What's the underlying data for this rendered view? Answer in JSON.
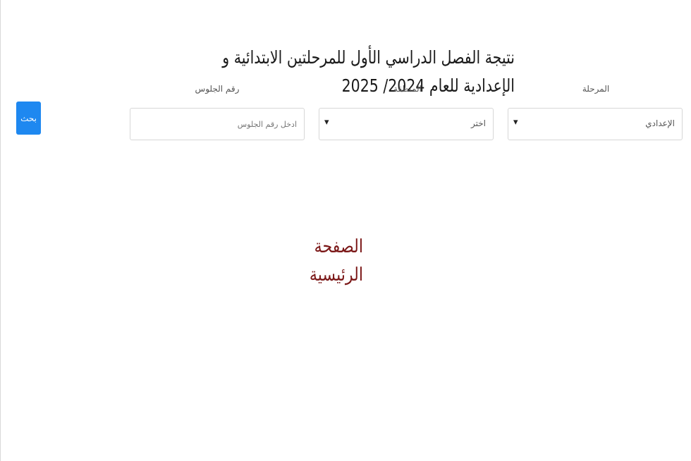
{
  "title": "نتيجة الفصل الدراسي الأول للمرحلتين الابتدائية و الإعدادية للعام 2024/ 2025",
  "form": {
    "stage": {
      "label": "المرحلة",
      "value": "الإعدادي"
    },
    "region": {
      "label": "المنطقة",
      "value": "اختر"
    },
    "seat": {
      "label": "رقم الجلوس",
      "placeholder": "ادخل رقم الجلوس"
    },
    "search_label": "بحث"
  },
  "home_link": "الصفحة الرئيسية",
  "icons": {
    "dropdown": "chevron-down-icon"
  },
  "colors": {
    "button": "#1e88f0",
    "home_link": "#7b1818"
  }
}
